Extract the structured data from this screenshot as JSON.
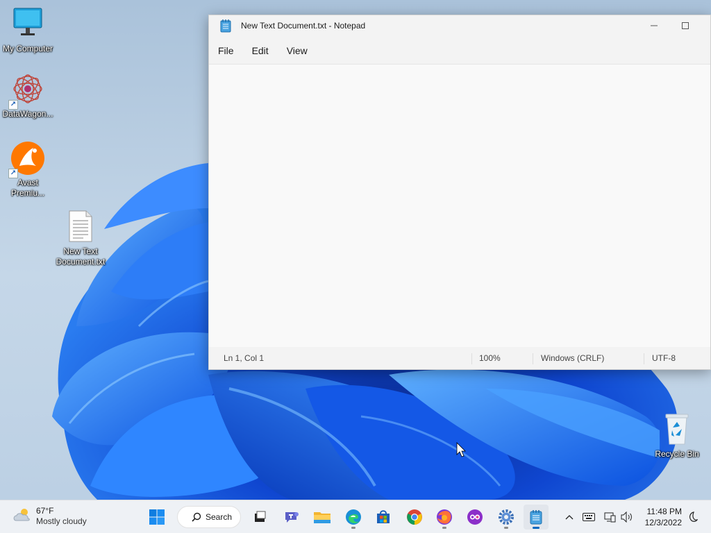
{
  "desktop": {
    "icons": [
      {
        "label": "My Computer"
      },
      {
        "label": "DataWagon..."
      },
      {
        "label": "Avast Premiu..."
      },
      {
        "label": "New Text Document.txt"
      },
      {
        "label": "Recycle Bin"
      }
    ]
  },
  "notepad": {
    "title": "New Text Document.txt - Notepad",
    "menu": [
      "File",
      "Edit",
      "View"
    ],
    "content": "",
    "status": {
      "position": "Ln 1, Col 1",
      "zoom": "100%",
      "line_ending": "Windows (CRLF)",
      "encoding": "UTF-8"
    }
  },
  "taskbar": {
    "weather": {
      "temp": "67°F",
      "condition": "Mostly cloudy"
    },
    "search_label": "Search",
    "pinned": [
      "start-icon",
      "task-view-icon",
      "teams-chat-icon",
      "file-explorer-icon",
      "edge-icon",
      "store-icon",
      "chrome-icon",
      "firefox-icon",
      "meeting-app-icon",
      "settings-icon",
      "notepad-icon"
    ],
    "clock": {
      "time": "11:48 PM",
      "date": "12/3/2022"
    }
  },
  "colors": {
    "accent": "#0067c0",
    "wallpaper": "#1f6fe6"
  }
}
